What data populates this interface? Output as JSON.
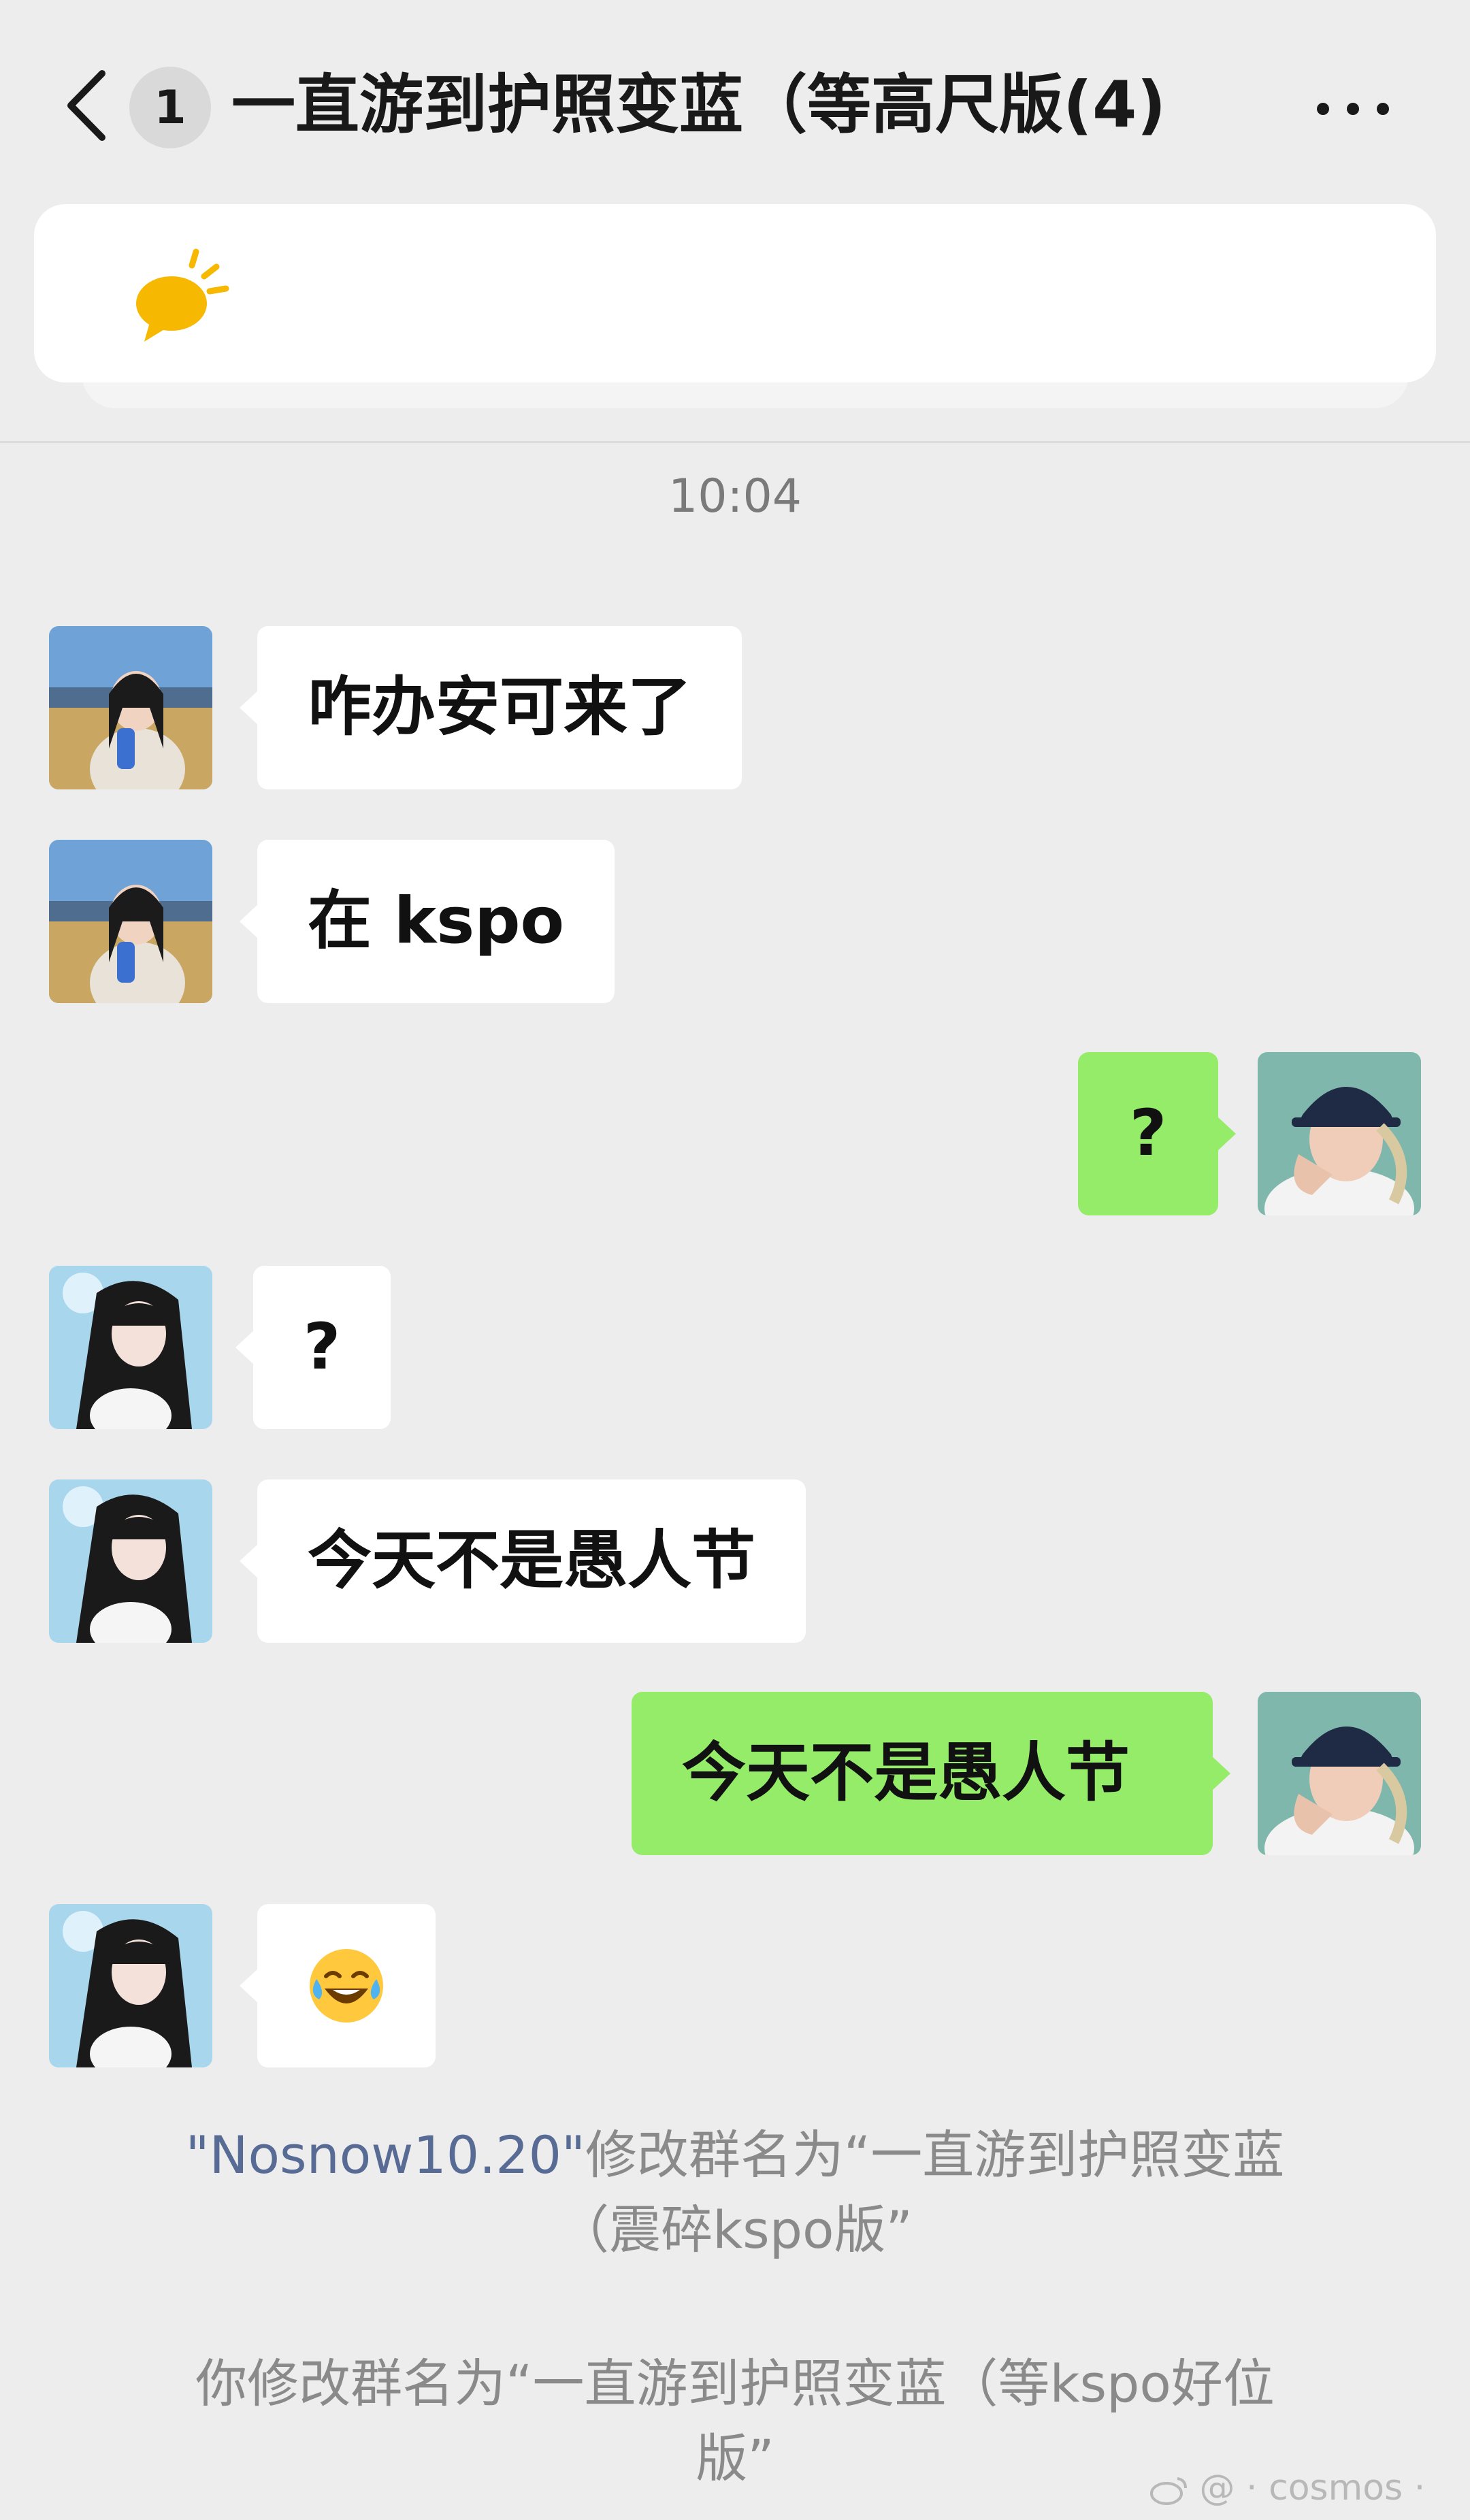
{
  "header": {
    "unread_count": "1",
    "title": "一直游到护照变蓝（等高尺版(4)"
  },
  "notice": {
    "icon": "megaphone-icon",
    "accent": "#f6b800"
  },
  "timestamp": "10:04",
  "messages": [
    {
      "side": "in",
      "sender_avatar": "avatar-girl-field",
      "text": "咋办安可来了"
    },
    {
      "side": "in",
      "sender_avatar": "avatar-girl-field",
      "text": "在 kspo"
    },
    {
      "side": "out",
      "sender_avatar": "avatar-me-cap",
      "text": "?"
    },
    {
      "side": "in",
      "sender_avatar": "avatar-girl-longhair",
      "text": "?"
    },
    {
      "side": "in",
      "sender_avatar": "avatar-girl-longhair",
      "text": "今天不是愚人节"
    },
    {
      "side": "out",
      "sender_avatar": "avatar-me-cap",
      "text": "今天不是愚人节"
    },
    {
      "side": "in",
      "sender_avatar": "avatar-girl-longhair",
      "emoji": "tears-of-joy-emoji"
    }
  ],
  "system": {
    "rename1_name": "\"Nosnow10.20\"",
    "rename1_line1": "修改群名为“一直游到护照变蓝",
    "rename1_line2": "（震碎kspo版”",
    "rename2_line1": "你修改群名为“一直游到护照变蓝（等kspo好位",
    "rename2_line2": "版”"
  },
  "watermark": "@ · cosmos ·",
  "colors": {
    "background": "#ededed",
    "bubble_in": "#ffffff",
    "bubble_out": "#95ec69",
    "link_name": "#576b95"
  }
}
